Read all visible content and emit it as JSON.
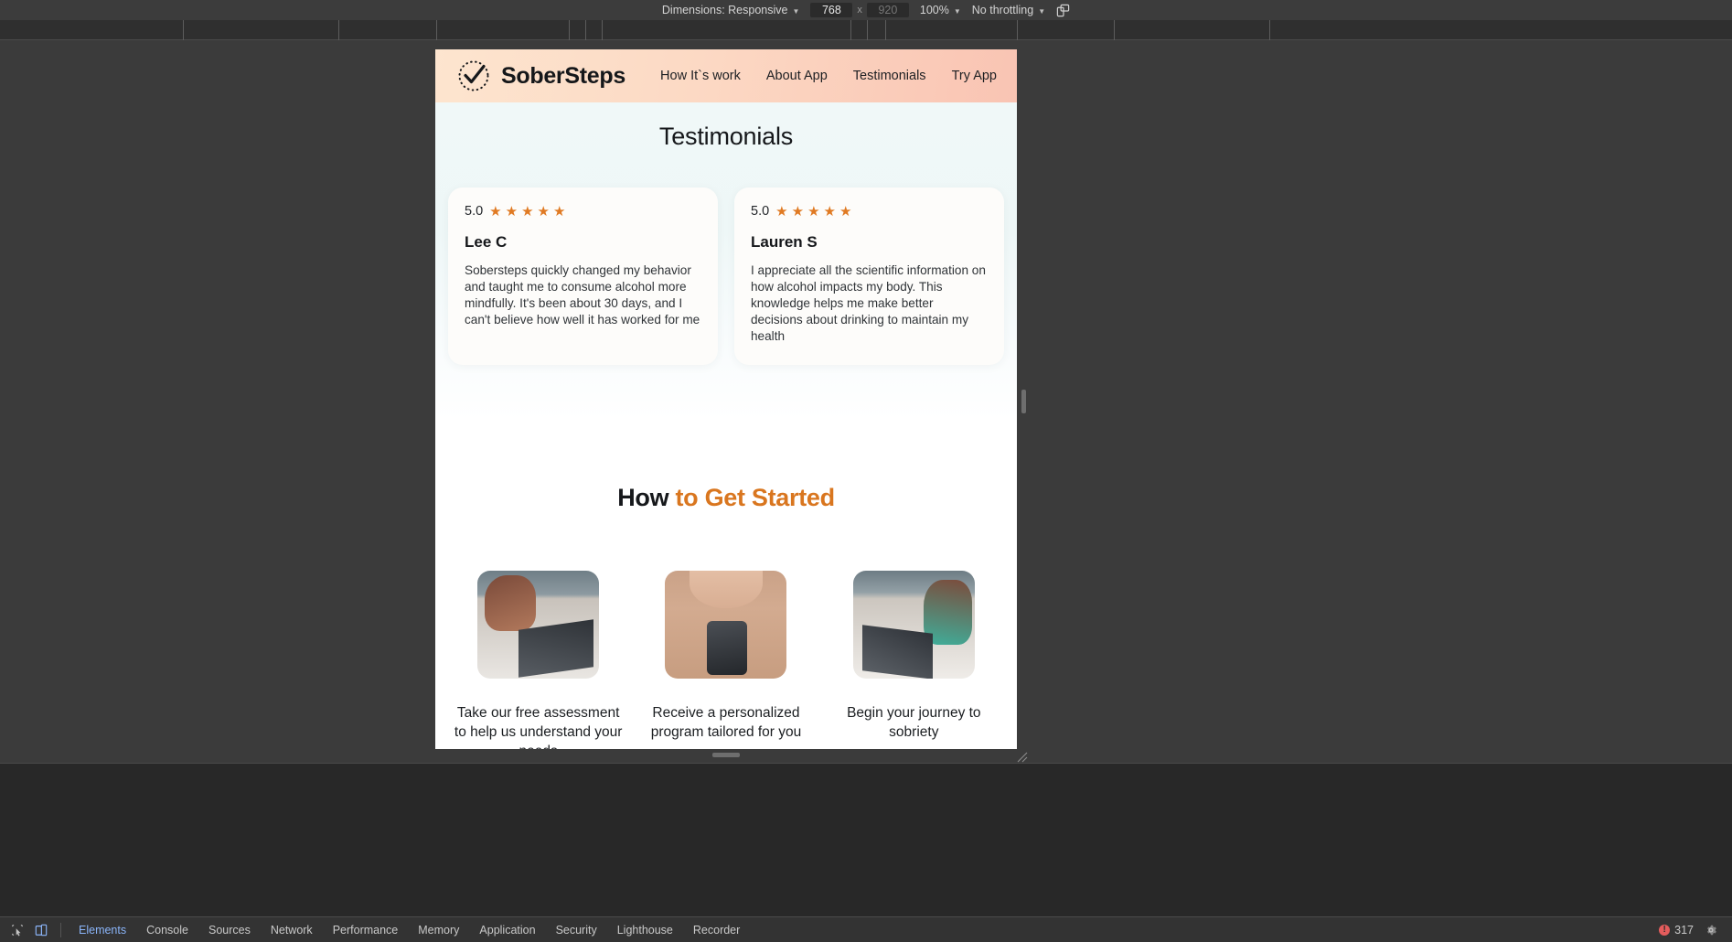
{
  "devtools": {
    "device_toolbar": {
      "dimensions_label": "Dimensions: Responsive",
      "width_value": "768",
      "height_placeholder": "920",
      "multiply_symbol": "x",
      "zoom_label": "100%",
      "throttling_label": "No throttling",
      "rotate_icon": "rotate-device-icon"
    },
    "bottom_tabs": [
      {
        "label": "Elements",
        "active": true
      },
      {
        "label": "Console",
        "active": false
      },
      {
        "label": "Sources",
        "active": false
      },
      {
        "label": "Network",
        "active": false
      },
      {
        "label": "Performance",
        "active": false
      },
      {
        "label": "Memory",
        "active": false
      },
      {
        "label": "Application",
        "active": false
      },
      {
        "label": "Security",
        "active": false
      },
      {
        "label": "Lighthouse",
        "active": false
      },
      {
        "label": "Recorder",
        "active": false
      }
    ],
    "inspect_icon": "inspect-element-icon",
    "device_toggle_icon": "toggle-device-toolbar-icon",
    "error_count": "317",
    "error_icon": "error-icon",
    "settings_icon": "gear-icon"
  },
  "site": {
    "header": {
      "logo_icon": "checkmark-circle-logo-icon",
      "brand_name": "SoberSteps",
      "nav": [
        {
          "label": "How It`s work"
        },
        {
          "label": "About App"
        },
        {
          "label": "Testimonials"
        },
        {
          "label": "Try App"
        }
      ]
    },
    "testimonials": {
      "title": "Testimonials",
      "star_glyph": "★",
      "cards": [
        {
          "rating": "5.0",
          "stars": 5,
          "name": "Lee C",
          "text": "Sobersteps quickly changed my behavior and taught me to consume alcohol more mindfully. It's been about 30 days, and I can't believe how well it has worked for me"
        },
        {
          "rating": "5.0",
          "stars": 5,
          "name": "Lauren S",
          "text": "I appreciate all the scientific information on how alcohol impacts my body. This knowledge helps me make better decisions about drinking to maintain my health"
        }
      ]
    },
    "get_started": {
      "title_lead": "How ",
      "title_accent": "to Get Started",
      "accent_color": "#d9761f",
      "steps": [
        {
          "photo": "woman-using-laptop-photo",
          "caption": "Take our free assessment to help us understand your needs"
        },
        {
          "photo": "woman-holding-phone-photo",
          "caption": "Receive a personalized program tailored for you"
        },
        {
          "photo": "woman-at-desk-with-phone-photo",
          "caption": "Begin your journey to sobriety"
        }
      ]
    }
  }
}
